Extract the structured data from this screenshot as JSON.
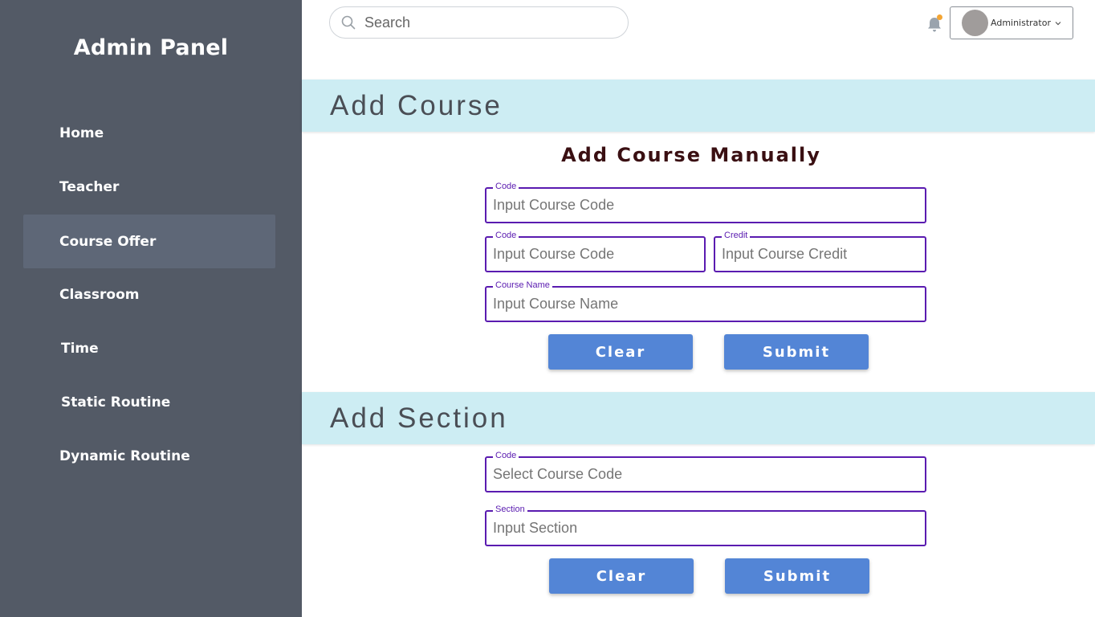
{
  "sidebar": {
    "title": "Admin Panel",
    "items": [
      {
        "label": "Home"
      },
      {
        "label": "Teacher"
      },
      {
        "label": "Course Offer"
      },
      {
        "label": "Classroom"
      },
      {
        "label": "Time"
      },
      {
        "label": "Static Routine"
      },
      {
        "label": "Dynamic Routine"
      }
    ],
    "active": "Course Offer"
  },
  "header": {
    "search_placeholder": "Search",
    "user_name": "Administrator",
    "icons": [
      "search-icon",
      "bell-icon",
      "chevron-down-icon"
    ],
    "notification_dot_color": "#f4a533"
  },
  "add_course": {
    "heading": "Add Course",
    "subheading": "Add Course Manually",
    "fields": [
      {
        "label": "Code",
        "placeholder": "Input Course Code"
      },
      {
        "label": "Code",
        "placeholder": "Input Course Code"
      },
      {
        "label": "Credit",
        "placeholder": "Input Course Credit"
      },
      {
        "label": "Course Name",
        "placeholder": "Input Course Name"
      }
    ],
    "clear_label": "Clear",
    "submit_label": "Submit"
  },
  "add_section": {
    "heading": "Add Section",
    "fields": [
      {
        "label": "Code",
        "placeholder": "Select Course Code"
      },
      {
        "label": "Section",
        "placeholder": "Input Section"
      }
    ],
    "clear_label": "Clear",
    "submit_label": "Submit"
  },
  "colors": {
    "sidebar_bg": "#535a66",
    "sidebar_active": "#5e6777",
    "band_bg": "#cdedf3",
    "field_border": "#5a1bb0",
    "button_bg": "#5385d6"
  }
}
